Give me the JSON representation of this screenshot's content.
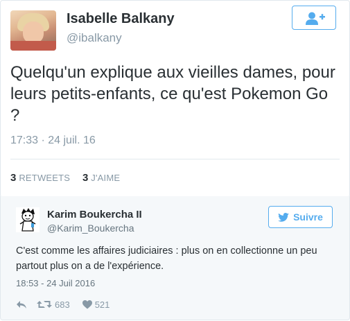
{
  "main_tweet": {
    "author_name": "Isabelle Balkany",
    "author_handle": "@ibalkany",
    "text": "Quelqu'un explique aux vieilles dames, pour leurs petits-enfants, ce qu'est Pokemon Go ?",
    "timestamp": "17:33 · 24 juil. 16",
    "retweets_count": "3",
    "retweets_label": "RETWEETS",
    "likes_count": "3",
    "likes_label": "J'AIME",
    "follow_icon": "add-user-icon"
  },
  "reply_tweet": {
    "author_name": "Karim Boukercha II",
    "author_handle": "@Karim_Boukercha",
    "follow_label": "Suivre",
    "text": "C'est comme les affaires judiciaires : plus on en collectionne un peu partout plus on a de l'expérience.",
    "timestamp": "18:53 - 24 Juil 2016",
    "retweet_count": "683",
    "like_count": "521"
  },
  "colors": {
    "accent": "#55acee",
    "text": "#292f33",
    "muted": "#8899a6",
    "border": "#e1e8ed",
    "embed_bg": "#f5f8fa"
  }
}
